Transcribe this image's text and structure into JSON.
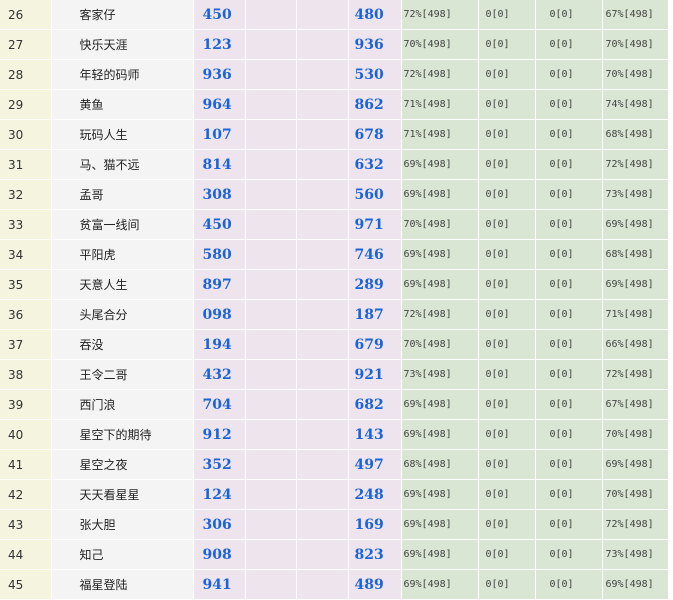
{
  "rows": [
    {
      "rank": "26",
      "name": "客家仔",
      "num1": "450",
      "num2": "480",
      "p1": "72%[498]",
      "p2": "0[0]",
      "p3": "0[0]",
      "p4": "67%[498]"
    },
    {
      "rank": "27",
      "name": "快乐天涯",
      "num1": "123",
      "num2": "936",
      "p1": "70%[498]",
      "p2": "0[0]",
      "p3": "0[0]",
      "p4": "70%[498]"
    },
    {
      "rank": "28",
      "name": "年轻的码师",
      "num1": "936",
      "num2": "530",
      "p1": "72%[498]",
      "p2": "0[0]",
      "p3": "0[0]",
      "p4": "70%[498]"
    },
    {
      "rank": "29",
      "name": "黄鱼",
      "num1": "964",
      "num2": "862",
      "p1": "71%[498]",
      "p2": "0[0]",
      "p3": "0[0]",
      "p4": "74%[498]"
    },
    {
      "rank": "30",
      "name": "玩码人生",
      "num1": "107",
      "num2": "678",
      "p1": "71%[498]",
      "p2": "0[0]",
      "p3": "0[0]",
      "p4": "68%[498]"
    },
    {
      "rank": "31",
      "name": "马、猫不远",
      "num1": "814",
      "num2": "632",
      "p1": "69%[498]",
      "p2": "0[0]",
      "p3": "0[0]",
      "p4": "72%[498]"
    },
    {
      "rank": "32",
      "name": "孟哥",
      "num1": "308",
      "num2": "560",
      "p1": "69%[498]",
      "p2": "0[0]",
      "p3": "0[0]",
      "p4": "73%[498]"
    },
    {
      "rank": "33",
      "name": "贫富一线间",
      "num1": "450",
      "num2": "971",
      "p1": "70%[498]",
      "p2": "0[0]",
      "p3": "0[0]",
      "p4": "69%[498]"
    },
    {
      "rank": "34",
      "name": "平阳虎",
      "num1": "580",
      "num2": "746",
      "p1": "69%[498]",
      "p2": "0[0]",
      "p3": "0[0]",
      "p4": "68%[498]"
    },
    {
      "rank": "35",
      "name": "天意人生",
      "num1": "897",
      "num2": "289",
      "p1": "69%[498]",
      "p2": "0[0]",
      "p3": "0[0]",
      "p4": "69%[498]"
    },
    {
      "rank": "36",
      "name": "头尾合分",
      "num1": "098",
      "num2": "187",
      "p1": "72%[498]",
      "p2": "0[0]",
      "p3": "0[0]",
      "p4": "71%[498]"
    },
    {
      "rank": "37",
      "name": "吞没",
      "num1": "194",
      "num2": "679",
      "p1": "70%[498]",
      "p2": "0[0]",
      "p3": "0[0]",
      "p4": "66%[498]"
    },
    {
      "rank": "38",
      "name": "王令二哥",
      "num1": "432",
      "num2": "921",
      "p1": "73%[498]",
      "p2": "0[0]",
      "p3": "0[0]",
      "p4": "72%[498]"
    },
    {
      "rank": "39",
      "name": "西门浪",
      "num1": "704",
      "num2": "682",
      "p1": "69%[498]",
      "p2": "0[0]",
      "p3": "0[0]",
      "p4": "67%[498]"
    },
    {
      "rank": "40",
      "name": "星空下的期待",
      "num1": "912",
      "num2": "143",
      "p1": "69%[498]",
      "p2": "0[0]",
      "p3": "0[0]",
      "p4": "70%[498]"
    },
    {
      "rank": "41",
      "name": "星空之夜",
      "num1": "352",
      "num2": "497",
      "p1": "68%[498]",
      "p2": "0[0]",
      "p3": "0[0]",
      "p4": "69%[498]"
    },
    {
      "rank": "42",
      "name": "天天看星星",
      "num1": "124",
      "num2": "248",
      "p1": "69%[498]",
      "p2": "0[0]",
      "p3": "0[0]",
      "p4": "70%[498]"
    },
    {
      "rank": "43",
      "name": "张大胆",
      "num1": "306",
      "num2": "169",
      "p1": "69%[498]",
      "p2": "0[0]",
      "p3": "0[0]",
      "p4": "72%[498]"
    },
    {
      "rank": "44",
      "name": "知己",
      "num1": "908",
      "num2": "823",
      "p1": "69%[498]",
      "p2": "0[0]",
      "p3": "0[0]",
      "p4": "73%[498]"
    },
    {
      "rank": "45",
      "name": "福星登陆",
      "num1": "941",
      "num2": "489",
      "p1": "69%[498]",
      "p2": "0[0]",
      "p3": "0[0]",
      "p4": "69%[498]"
    }
  ]
}
